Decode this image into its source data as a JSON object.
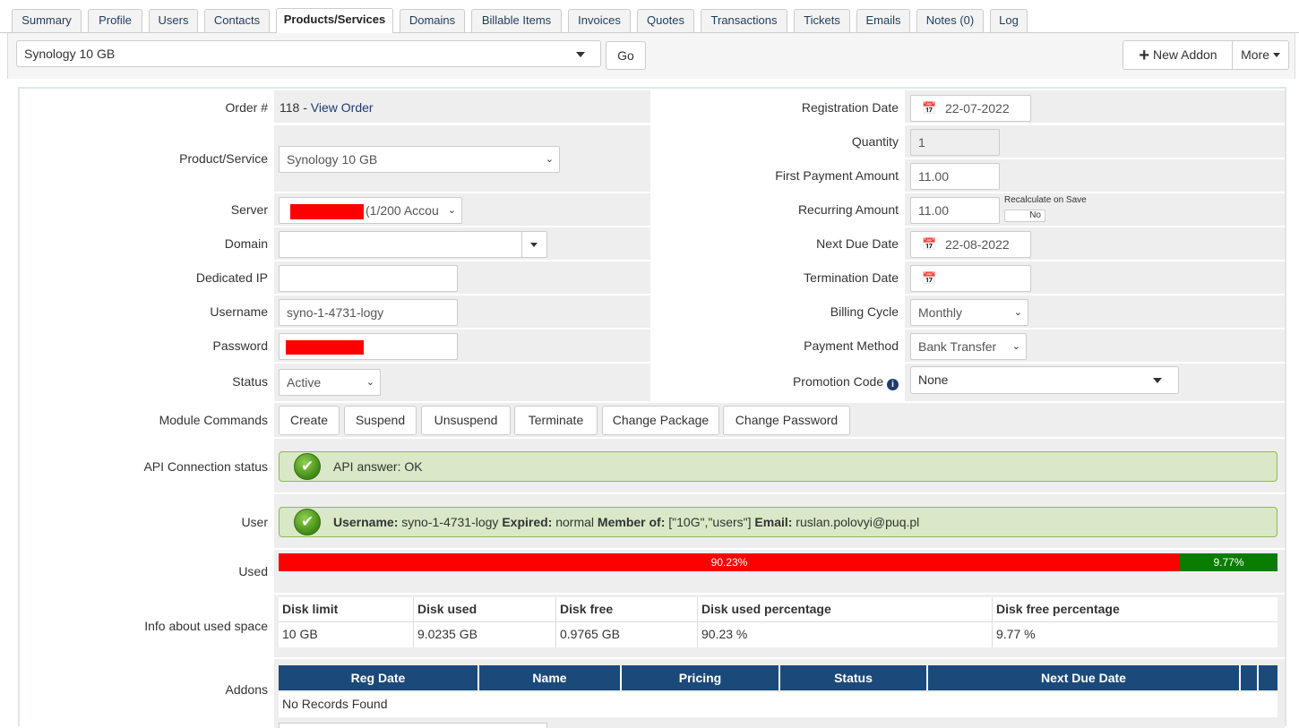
{
  "tabs": [
    "Summary",
    "Profile",
    "Users",
    "Contacts",
    "Products/Services",
    "Domains",
    "Billable Items",
    "Invoices",
    "Quotes",
    "Transactions",
    "Tickets",
    "Emails",
    "Notes (0)",
    "Log"
  ],
  "toolbar": {
    "service_select": "Synology 10 GB",
    "go": "Go",
    "new_addon": "New Addon",
    "more": "More"
  },
  "left": {
    "order_label": "Order #",
    "order_number": "118",
    "order_sep": " - ",
    "view_order": "View Order",
    "product_label": "Product/Service",
    "product_value": "Synology 10 GB",
    "server_label": "Server",
    "server_value": "(1/200 Accou",
    "domain_label": "Domain",
    "domain_value": "",
    "dedicated_ip_label": "Dedicated IP",
    "dedicated_ip_value": "",
    "username_label": "Username",
    "username_value": "syno-1-4731-logy",
    "password_label": "Password",
    "status_label": "Status",
    "status_value": "Active"
  },
  "right": {
    "reg_date_label": "Registration Date",
    "reg_date_value": "22-07-2022",
    "quantity_label": "Quantity",
    "quantity_value": "1",
    "first_payment_label": "First Payment Amount",
    "first_payment_value": "11.00",
    "recurring_label": "Recurring Amount",
    "recurring_value": "11.00",
    "recalc_label": "Recalculate on Save",
    "recalc_toggle": "No",
    "next_due_label": "Next Due Date",
    "next_due_value": "22-08-2022",
    "termination_label": "Termination Date",
    "termination_value": "",
    "billing_cycle_label": "Billing Cycle",
    "billing_cycle_value": "Monthly",
    "payment_method_label": "Payment Method",
    "payment_method_value": "Bank Transfer",
    "promo_label": "Promotion Code",
    "promo_value": "None"
  },
  "module": {
    "label": "Module Commands",
    "buttons": [
      "Create",
      "Suspend",
      "Unsuspend",
      "Terminate",
      "Change Package",
      "Change Password"
    ]
  },
  "api": {
    "label": "API Connection status",
    "message": "API answer: OK"
  },
  "user": {
    "label": "User",
    "username_key": "Username:",
    "username_val": " syno-1-4731-logy ",
    "expired_key": "Expired:",
    "expired_val": " normal ",
    "member_key": "Member of:",
    "member_val": " [\"10G\",\"users\"] ",
    "email_key": "Email:",
    "email_val": " ruslan.polovyi@puq.pl"
  },
  "used": {
    "label": "Used",
    "used_pct": 90.23,
    "free_pct": 9.77,
    "used_text": "90.23%",
    "free_text": "9.77%",
    "used_color": "#ff0000",
    "free_color": "#0a7d00"
  },
  "space": {
    "label": "Info about used space",
    "headers": [
      "Disk limit",
      "Disk used",
      "Disk free",
      "Disk used percentage",
      "Disk free percentage"
    ],
    "row": [
      "10 GB",
      "9.0235 GB",
      "0.9765 GB",
      "90.23 %",
      "9.77 %"
    ]
  },
  "addons": {
    "label": "Addons",
    "headers": [
      "Reg Date",
      "Name",
      "Pricing",
      "Status",
      "Next Due Date",
      "",
      ""
    ],
    "empty": "No Records Found"
  }
}
